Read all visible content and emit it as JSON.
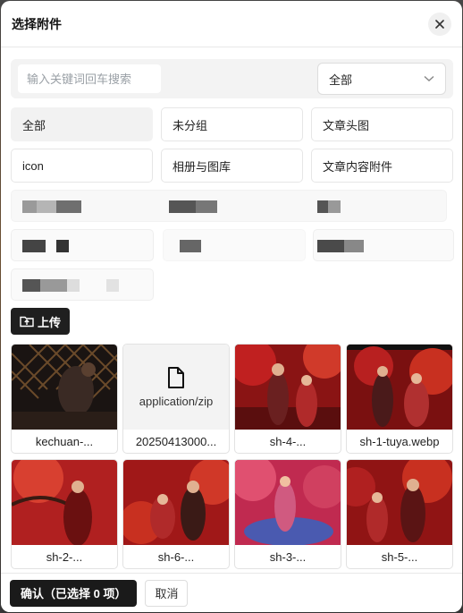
{
  "dialog": {
    "title": "选择附件"
  },
  "search": {
    "placeholder": "输入关键词回车搜索",
    "value": "",
    "filter_selected": "全部"
  },
  "groups": [
    {
      "label": "全部",
      "active": true
    },
    {
      "label": "未分组",
      "active": false
    },
    {
      "label": "文章头图",
      "active": false
    },
    {
      "label": "icon",
      "active": false
    },
    {
      "label": "相册与图库",
      "active": false
    },
    {
      "label": "文章内容附件",
      "active": false
    }
  ],
  "upload_label": "上传",
  "attachments": [
    {
      "name": "kechuan-...",
      "kind": "image"
    },
    {
      "name": "20250413000...",
      "kind": "file",
      "mime": "application/zip"
    },
    {
      "name": "sh-4-...",
      "kind": "image"
    },
    {
      "name": "sh-1-tuya.webp",
      "kind": "image"
    },
    {
      "name": "sh-2-...",
      "kind": "image"
    },
    {
      "name": "sh-6-...",
      "kind": "image"
    },
    {
      "name": "sh-3-...",
      "kind": "image"
    },
    {
      "name": "sh-5-...",
      "kind": "image"
    }
  ],
  "footer": {
    "confirm_label": "确认（已选择 0 项）",
    "cancel_label": "取消"
  },
  "colors": {
    "primary": "#1a1a1a",
    "active_group_bg": "#f2f2f2",
    "border": "#e6e6e6"
  }
}
